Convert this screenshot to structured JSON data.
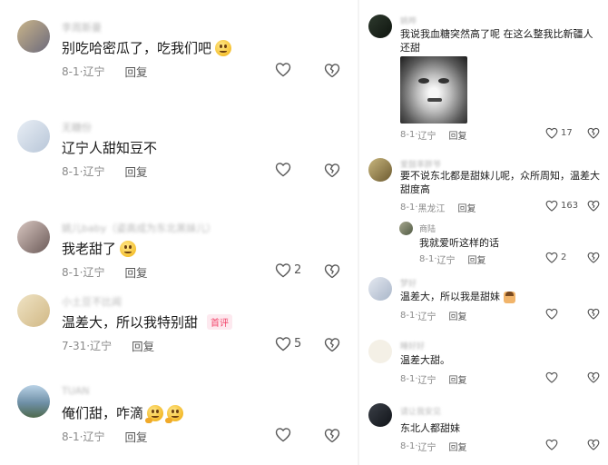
{
  "left_comments": [
    {
      "user": "李周斯曼",
      "text": "别吃哈密瓜了，吃我们吧",
      "emoji": "smile",
      "date": "8-1",
      "location": "辽宁",
      "reply": "回复",
      "likes": ""
    },
    {
      "user": "无糖份",
      "text": "辽宁人甜知豆不",
      "emoji": "",
      "date": "8-1",
      "location": "辽宁",
      "reply": "回复",
      "likes": ""
    },
    {
      "user": "姚儿baby（姿高成为东北黑妹儿）",
      "text": "我老甜了",
      "emoji": "grin",
      "date": "8-1",
      "location": "辽宁",
      "reply": "回复",
      "likes": "2"
    },
    {
      "user": "小土豆不比闻",
      "text": "温差大，所以我特别甜",
      "emoji": "",
      "badge": "首评",
      "date": "7-31",
      "location": "辽宁",
      "reply": "回复",
      "likes": "5"
    },
    {
      "user": "TUAN",
      "text": "俺们甜，咋滴",
      "emoji": "think2",
      "date": "8-1",
      "location": "辽宁",
      "reply": "回复",
      "likes": ""
    }
  ],
  "right_comments": [
    {
      "user": "姚晔",
      "text": "我说我血糖突然高了呢 在这么整我比新疆人还甜",
      "date": "8-1",
      "location": "辽宁",
      "reply": "回复",
      "likes": "17",
      "has_image": true
    },
    {
      "user": "爱鼓率胖爷",
      "text": "要不说东北都是甜妹儿呢，众所周知，温差大甜度高",
      "date": "8-1",
      "location": "黑龙江",
      "reply": "回复",
      "likes": "163"
    },
    {
      "user": "商陆",
      "text": "我就爱听这样的话",
      "date": "8-1",
      "location": "辽宁",
      "reply": "回复",
      "likes": "2",
      "is_reply": true
    },
    {
      "user": "梦好",
      "text": "温差大，所以我是甜妹",
      "date": "8-1",
      "location": "辽宁",
      "reply": "回复",
      "likes": ""
    },
    {
      "user": "睡好好",
      "text": "温差大甜。",
      "date": "8-1",
      "location": "辽宁",
      "reply": "回复",
      "likes": ""
    },
    {
      "user": "请让我安见",
      "text": "东北人都甜妹",
      "date": "8-1",
      "location": "辽宁",
      "reply": "回复",
      "likes": ""
    }
  ],
  "separator": "·",
  "colors": {
    "accent": "#f2456b",
    "meta": "#8a8a8a",
    "text": "#1a1a1a"
  }
}
